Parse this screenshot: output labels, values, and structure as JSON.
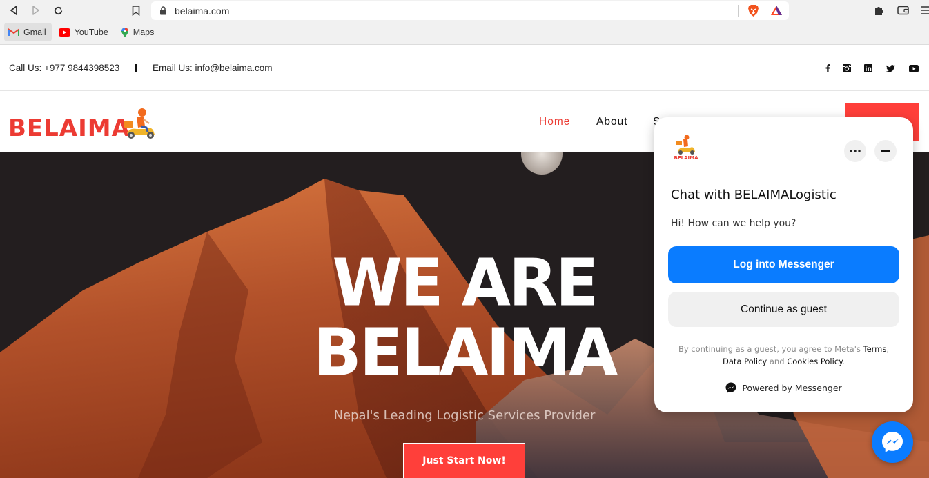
{
  "browser": {
    "url": "belaima.com",
    "bookmarks": [
      {
        "label": "Gmail",
        "icon": "gmail-icon"
      },
      {
        "label": "YouTube",
        "icon": "youtube-icon"
      },
      {
        "label": "Maps",
        "icon": "maps-icon"
      }
    ]
  },
  "topbar": {
    "call": "Call Us: +977 9844398523",
    "email": "Email Us: info@belaima.com",
    "social": [
      "facebook",
      "instagram",
      "linkedin",
      "twitter",
      "youtube"
    ]
  },
  "header": {
    "logo": "BELAIMA",
    "nav": [
      {
        "label": "Home",
        "active": true
      },
      {
        "label": "About",
        "active": false
      },
      {
        "label": "S",
        "active": false
      }
    ]
  },
  "hero": {
    "title_line1": "WE ARE",
    "title_line2": "BELAIMA",
    "subtitle": "Nepal's Leading Logistic Services Provider",
    "cta": "Just Start Now!"
  },
  "chat": {
    "logo_text": "BELAIMA",
    "title": "Chat with BELAIMALogistic",
    "greeting": "Hi! How can we help you?",
    "login_button": "Log into Messenger",
    "guest_button": "Continue as guest",
    "legal_prefix": "By continuing as a guest, you agree to Meta's ",
    "legal_terms": "Terms",
    "legal_comma": ",",
    "legal_data_policy": "Data Policy",
    "legal_and": " and ",
    "legal_cookies": "Cookies Policy",
    "legal_end": ".",
    "powered_by": "Powered by Messenger"
  },
  "colors": {
    "brand_red": "#ec3b33",
    "cta_red": "#ff3f3a",
    "messenger_blue": "#0a7cff"
  }
}
